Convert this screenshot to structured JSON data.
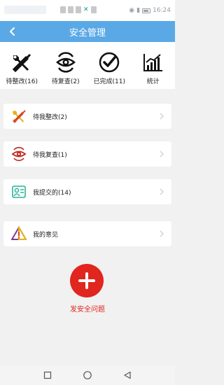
{
  "status_bar": {
    "right_text": "16:24",
    "battery_percent": "0"
  },
  "header": {
    "title": "安全管理",
    "bg_color": "#5aa9e6"
  },
  "tabs": [
    {
      "label": "待整改(16)",
      "icon": "wrench-screwdriver-icon"
    },
    {
      "label": "待复查(2)",
      "icon": "eye-review-icon"
    },
    {
      "label": "已完成(11)",
      "icon": "check-circle-icon"
    },
    {
      "label": "统计",
      "icon": "bar-chart-icon"
    }
  ],
  "list": [
    {
      "label": "待我整改(2)",
      "icon": "tools-icon"
    },
    {
      "label": "待我复查(1)",
      "icon": "eye-icon"
    },
    {
      "label": "我提交的(14)",
      "icon": "user-card-icon"
    },
    {
      "label": "我的意见",
      "icon": "warning-triangle-icon"
    }
  ],
  "fab": {
    "label": "发安全问题",
    "color": "#e0261e"
  }
}
